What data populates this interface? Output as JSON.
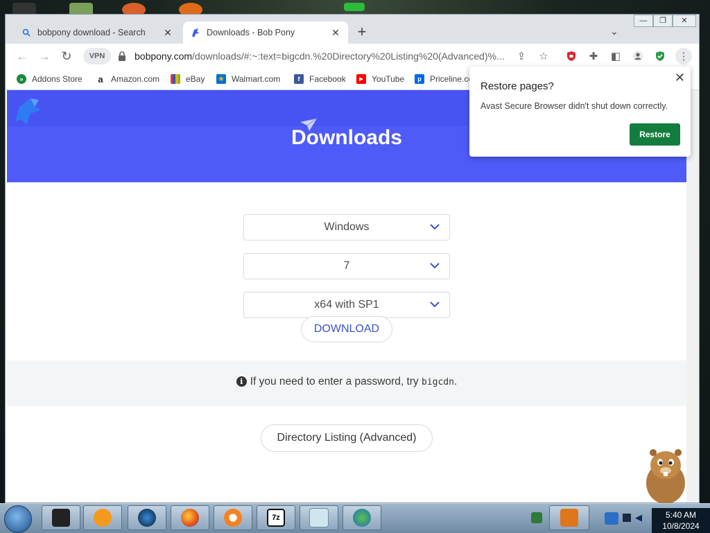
{
  "browser": {
    "tabs": [
      {
        "title": "bobpony download - Search",
        "active": false,
        "icon": "search-icon"
      },
      {
        "title": "Downloads - Bob Pony",
        "active": true,
        "icon": "bobpony-favicon"
      }
    ],
    "window_controls": {
      "minimize": "—",
      "restore": "❐",
      "close": "✕"
    },
    "vpn_label": "VPN",
    "url_host": "bobpony.com",
    "url_path": "/downloads/#:~:text=bigcdn.%20Directory%20Listing%20(Advanced)%...",
    "bookmarks": [
      {
        "label": "Addons Store",
        "icon": "addons-store-icon",
        "color": "#1a8a3a"
      },
      {
        "label": "Amazon.com",
        "icon": "amazon-icon",
        "color": "#222222"
      },
      {
        "label": "eBay",
        "icon": "ebay-icon",
        "color": "#e53238"
      },
      {
        "label": "Walmart.com",
        "icon": "walmart-icon",
        "color": "#0071ce"
      },
      {
        "label": "Facebook",
        "icon": "facebook-icon",
        "color": "#3b5998"
      },
      {
        "label": "YouTube",
        "icon": "youtube-icon",
        "color": "#ff0000"
      },
      {
        "label": "Priceline.co",
        "icon": "priceline-icon",
        "color": "#0068ef"
      }
    ]
  },
  "page": {
    "hero_title": "Downloads",
    "selects": [
      {
        "name": "os-select",
        "value": "Windows"
      },
      {
        "name": "version-select",
        "value": "7"
      },
      {
        "name": "edition-select",
        "value": "x64 with SP1"
      }
    ],
    "download_label": "DOWNLOAD",
    "info_text": "If you need to enter a password, try ",
    "info_code": "bigcdn",
    "info_tail": ".",
    "directory_button": "Directory Listing (Advanced)",
    "hero_color": "#4f5bf7"
  },
  "popup": {
    "title": "Restore pages?",
    "message": "Avast Secure Browser didn't shut down correctly.",
    "button": "Restore",
    "button_color": "#137c3e"
  },
  "taskbar": {
    "time": "5:40 AM",
    "date": "10/8/2024",
    "pinned": [
      "window-icon",
      "media-player-icon",
      "globe-icon",
      "firefox-icon",
      "avast-browser-icon",
      "7zip-icon",
      "notepad-icon",
      "network-icon"
    ]
  }
}
